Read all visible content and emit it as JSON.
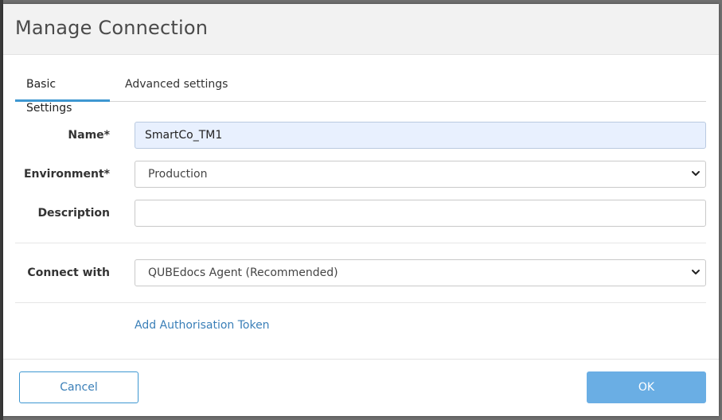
{
  "dialog": {
    "title": "Manage Connection"
  },
  "tabs": [
    {
      "label": "Basic Settings",
      "active": true
    },
    {
      "label": "Advanced settings",
      "active": false
    }
  ],
  "form": {
    "name_label": "Name*",
    "name_value": "SmartCo_TM1",
    "environment_label": "Environment*",
    "environment_value": "Production",
    "description_label": "Description",
    "description_value": "",
    "connect_label": "Connect with",
    "connect_value": "QUBEdocs Agent (Recommended)",
    "auth_link": "Add Authorisation Token"
  },
  "footer": {
    "cancel_label": "Cancel",
    "ok_label": "OK"
  },
  "colors": {
    "accent": "#3e97d1",
    "ok_button": "#6aaee4",
    "autofill_bg": "#e8f0fe"
  },
  "icons": [
    "chevron-down-icon"
  ]
}
